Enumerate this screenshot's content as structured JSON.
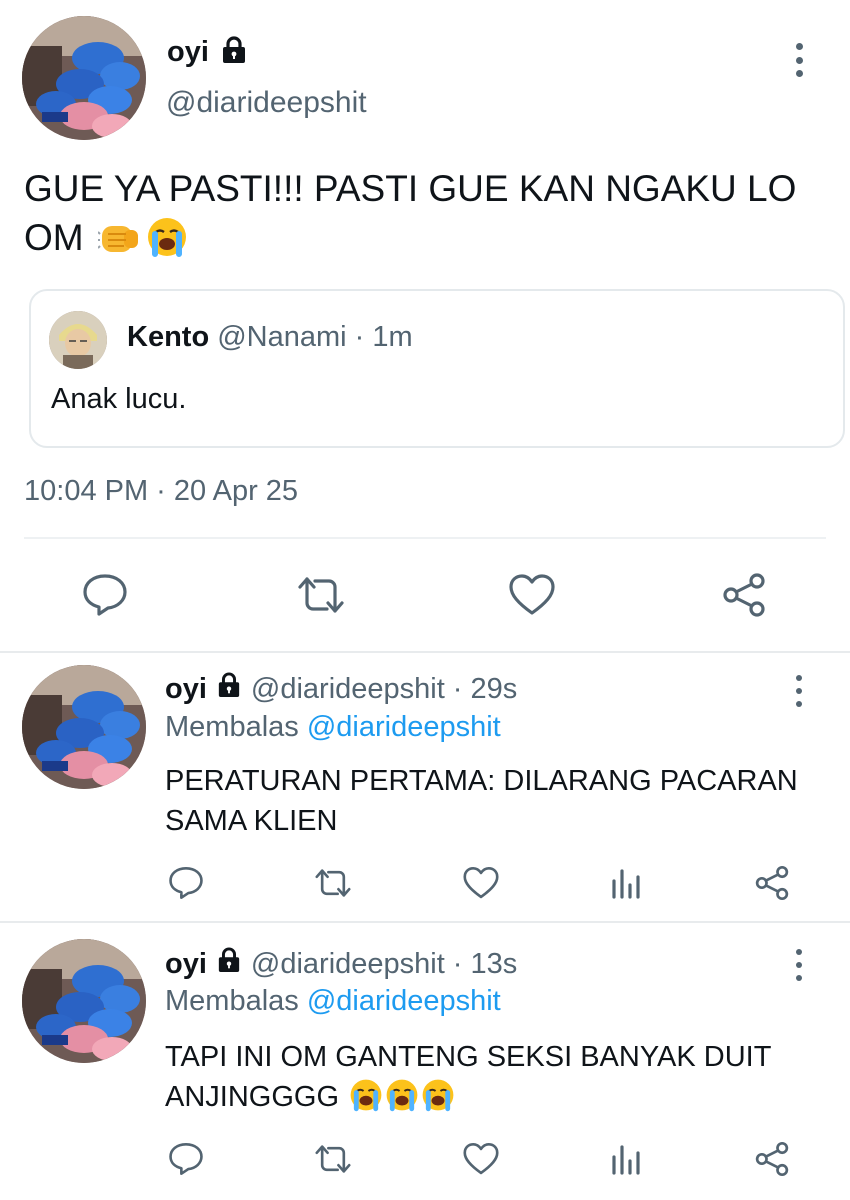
{
  "main_tweet": {
    "name": "oyi",
    "handle": "@diarideepshit",
    "text": "GUE YA PASTI!!! PASTI GUE KAN NGAKU LO OM",
    "text_emojis": [
      "oncoming-fist-emoji",
      "loudly-crying-face-emoji"
    ],
    "timestamp": "10:04 PM · 20 Apr 25",
    "icons": {
      "lock": "lock-icon",
      "more": "more-vertical-icon",
      "reply": "reply-icon",
      "retweet": "retweet-icon",
      "like": "heart-icon",
      "share": "share-icon"
    }
  },
  "quoted_tweet": {
    "name": "Kento",
    "handle": "@Nanami",
    "time": "1m",
    "separator": "·",
    "text": "Anak lucu."
  },
  "replies": [
    {
      "name": "oyi",
      "handle": "@diarideepshit",
      "separator": "·",
      "time": "29s",
      "replying_prefix": "Membalas",
      "replying_to": "@diarideepshit",
      "text": "PERATURAN PERTAMA: DILARANG PACARAN SAMA KLIEN",
      "text_emojis": []
    },
    {
      "name": "oyi",
      "handle": "@diarideepshit",
      "separator": "·",
      "time": "13s",
      "replying_prefix": "Membalas",
      "replying_to": "@diarideepshit",
      "text": "TAPI INI OM GANTENG SEKSI BANYAK DUIT ANJINGGGG",
      "text_emojis": [
        "loudly-crying-face-emoji",
        "loudly-crying-face-emoji",
        "loudly-crying-face-emoji"
      ]
    }
  ],
  "colors": {
    "text": "#0f1419",
    "muted": "#536471",
    "link": "#1d9bf0",
    "border": "#e4e9ec"
  }
}
